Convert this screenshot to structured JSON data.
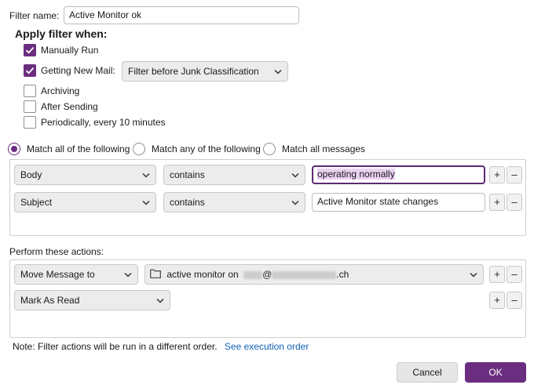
{
  "filter_name": {
    "label": "Filter name:",
    "value": "Active Monitor ok"
  },
  "apply_when": {
    "heading": "Apply filter when:",
    "manually_run": {
      "label": "Manually Run",
      "checked": true
    },
    "getting_new_mail": {
      "label": "Getting New Mail:",
      "checked": true,
      "select_value": "Filter before Junk Classification"
    },
    "archiving": {
      "label": "Archiving",
      "checked": false
    },
    "after_sending": {
      "label": "After Sending",
      "checked": false
    },
    "periodically": {
      "label": "Periodically, every 10 minutes",
      "checked": false
    }
  },
  "match": {
    "all": {
      "label": "Match all of the following",
      "selected": true
    },
    "any": {
      "label": "Match any of the following",
      "selected": false
    },
    "all_messages": {
      "label": "Match all messages",
      "selected": false
    }
  },
  "conditions": [
    {
      "field": "Body",
      "operator": "contains",
      "value": "operating normally"
    },
    {
      "field": "Subject",
      "operator": "contains",
      "value": "Active Monitor state changes"
    }
  ],
  "actions": {
    "heading": "Perform these actions:",
    "rows": [
      {
        "action": "Move Message to",
        "target_prefix": "active monitor on",
        "target_at": "@",
        "target_suffix": ".ch"
      },
      {
        "action": "Mark As Read"
      }
    ]
  },
  "note": {
    "text": "Note: Filter actions will be run in a different order.",
    "link": "See execution order"
  },
  "buttons": {
    "add": "+",
    "remove": "–",
    "cancel": "Cancel",
    "ok": "OK"
  },
  "colors": {
    "accent": "#6b2d7f",
    "link": "#1160b8",
    "highlight": "#ead1f1"
  }
}
